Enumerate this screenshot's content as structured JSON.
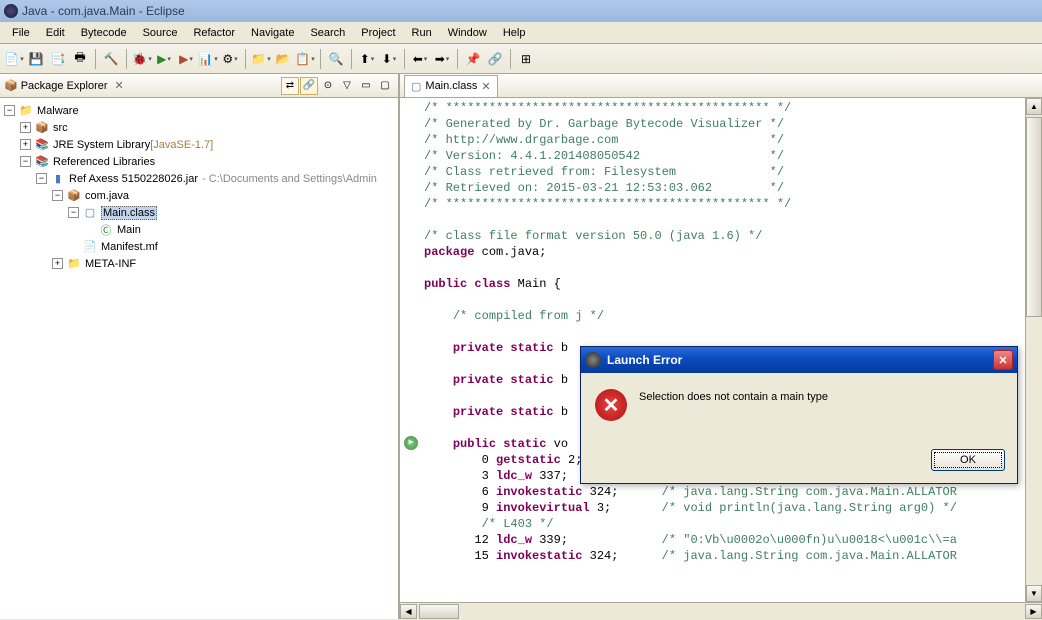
{
  "window": {
    "title": "Java - com.java.Main - Eclipse"
  },
  "menu": [
    "File",
    "Edit",
    "Bytecode",
    "Source",
    "Refactor",
    "Navigate",
    "Search",
    "Project",
    "Run",
    "Window",
    "Help"
  ],
  "explorer": {
    "title": "Package Explorer",
    "tree": {
      "project": "Malware",
      "src": "src",
      "jre": "JRE System Library",
      "jre_tag": "[JavaSE-1.7]",
      "reflibs": "Referenced Libraries",
      "jar": "Ref  Axess 5150228026.jar",
      "jar_path": "- C:\\Documents and Settings\\Admin",
      "pkg": "com.java",
      "mainclass": "Main.class",
      "maintype": "Main",
      "manifest": "Manifest.mf",
      "metainf": "META-INF"
    }
  },
  "editor": {
    "tab": "Main.class",
    "code": [
      {
        "t": "/* ********************************************* */",
        "c": "c-comment"
      },
      {
        "t": "/* Generated by Dr. Garbage Bytecode Visualizer */",
        "c": "c-comment"
      },
      {
        "t": "/* http://www.drgarbage.com                     */",
        "c": "c-comment"
      },
      {
        "t": "/* Version: 4.4.1.201408050542                  */",
        "c": "c-comment"
      },
      {
        "t": "/* Class retrieved from: Filesystem             */",
        "c": "c-comment"
      },
      {
        "t": "/* Retrieved on: 2015-03-21 12:53:03.062        */",
        "c": "c-comment"
      },
      {
        "t": "/* ********************************************* */",
        "c": "c-comment"
      },
      {
        "t": ""
      },
      {
        "t": "/* class file format version 50.0 (java 1.6) */",
        "c": "c-comment"
      },
      {
        "html": "<span class='c-keyword'>package</span> com.java;"
      },
      {
        "t": ""
      },
      {
        "html": "<span class='c-keyword'>public class</span> Main {"
      },
      {
        "t": ""
      },
      {
        "html": "    <span class='c-comment'>/* compiled from j */</span>"
      },
      {
        "t": ""
      },
      {
        "html": "    <span class='c-keyword'>private static</span> b"
      },
      {
        "t": ""
      },
      {
        "html": "    <span class='c-keyword'>private static</span> b"
      },
      {
        "t": ""
      },
      {
        "html": "    <span class='c-keyword'>private static</span> b"
      },
      {
        "t": ""
      },
      {
        "html": "    <span class='c-keyword'>public static</span> vo",
        "gutter": true
      },
      {
        "html": "        0 <span class='c-keyword'>getstatic</span> 2;           <span class='c-comment'>/* java.lang.System.out */</span>"
      },
      {
        "html": "        3 <span class='c-keyword'>ldc_w</span> 337;             <span class='c-comment'>/* \"wl\\u0011\\u000fr#^+V,Q/R#^+V,Q!\\\\-P/R1</span>"
      },
      {
        "html": "        6 <span class='c-keyword'>invokestatic</span> 324;      <span class='c-comment'>/* java.lang.String com.java.Main.ALLATOR</span>"
      },
      {
        "html": "        9 <span class='c-keyword'>invokevirtual</span> 3;       <span class='c-comment'>/* void println(java.lang.String arg0) */</span>"
      },
      {
        "html": "        <span class='c-comment'>/* L403 */</span>"
      },
      {
        "html": "       12 <span class='c-keyword'>ldc_w</span> 339;             <span class='c-comment'>/* \"0:Vb\\u0002o\\u000fn)u\\u0018<\\u001c\\\\=a</span>"
      },
      {
        "html": "       15 <span class='c-keyword'>invokestatic</span> 324;      <span class='c-comment'>/* java.lang.String com.java.Main.ALLATOR</span>"
      }
    ]
  },
  "dialog": {
    "title": "Launch Error",
    "message": "Selection does not contain a main type",
    "ok": "OK"
  }
}
